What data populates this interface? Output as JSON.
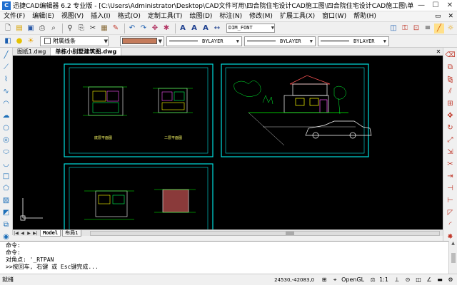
{
  "window": {
    "app_name": "迅捷CAD编辑器 6.2 专业版",
    "title": "迅捷CAD编辑器 6.2 专业版 - [C:\\Users\\Administrator\\Desktop\\CAD文件可用\\四合院住宅设计CAD施工图\\四合院住宅设计CAD施工图\\单...",
    "minimize": "—",
    "maximize": "☐",
    "close": "✕"
  },
  "menu": {
    "items": [
      "文件(F)",
      "编辑(E)",
      "视图(V)",
      "插入(I)",
      "格式(O)",
      "定制工具(T)",
      "绘图(D)",
      "标注(N)",
      "修改(M)",
      "扩展工具(X)",
      "窗口(W)",
      "帮助(H)"
    ],
    "restore": "▭",
    "close": "✕"
  },
  "toolbar1": {
    "icons": [
      "new-file-icon",
      "open-folder-icon",
      "save-icon",
      "print-icon",
      "print-preview-icon",
      "find-icon",
      "copy-icon",
      "cut-icon",
      "paste-icon",
      "match-props-icon",
      "undo-icon",
      "redo-icon",
      "pan-icon",
      "zoom-icon",
      "text-a-icon",
      "text-a2-icon",
      "text-a3-icon",
      "dim-style-icon"
    ],
    "dim_style": "DIM_FONT",
    "right_icons": [
      "layer-state-icon",
      "lock-icon",
      "plot-icon",
      "linewidth-icon",
      "redline-icon",
      "sun-icon"
    ]
  },
  "toolbar2": {
    "layer_name": "附属线条",
    "color": "#c47b5b",
    "linetype": "BYLAYER",
    "lineweight": "BYLAYER",
    "plotstyle": "BYLAYER"
  },
  "tabs": {
    "items": [
      "图纸1.dwg",
      "单栋小别墅建筑图.dwg"
    ],
    "close": "✕"
  },
  "sheets": {
    "label_first_floor": "底层平面图",
    "label_second_floor": "二层平面图"
  },
  "model_tabs": {
    "nav": [
      "|◀",
      "◀",
      "▶",
      "▶|"
    ],
    "items": [
      "Model",
      "布局1"
    ]
  },
  "command": {
    "lines": [
      "命令:",
      "命令:",
      "对角点: '_RTPAN",
      ">>按回车, 右键 或 Esc键完成..."
    ]
  },
  "status": {
    "state": "就绪",
    "coords": "24530,-42083,0",
    "render": "OpenGL",
    "scale": "1:1"
  }
}
